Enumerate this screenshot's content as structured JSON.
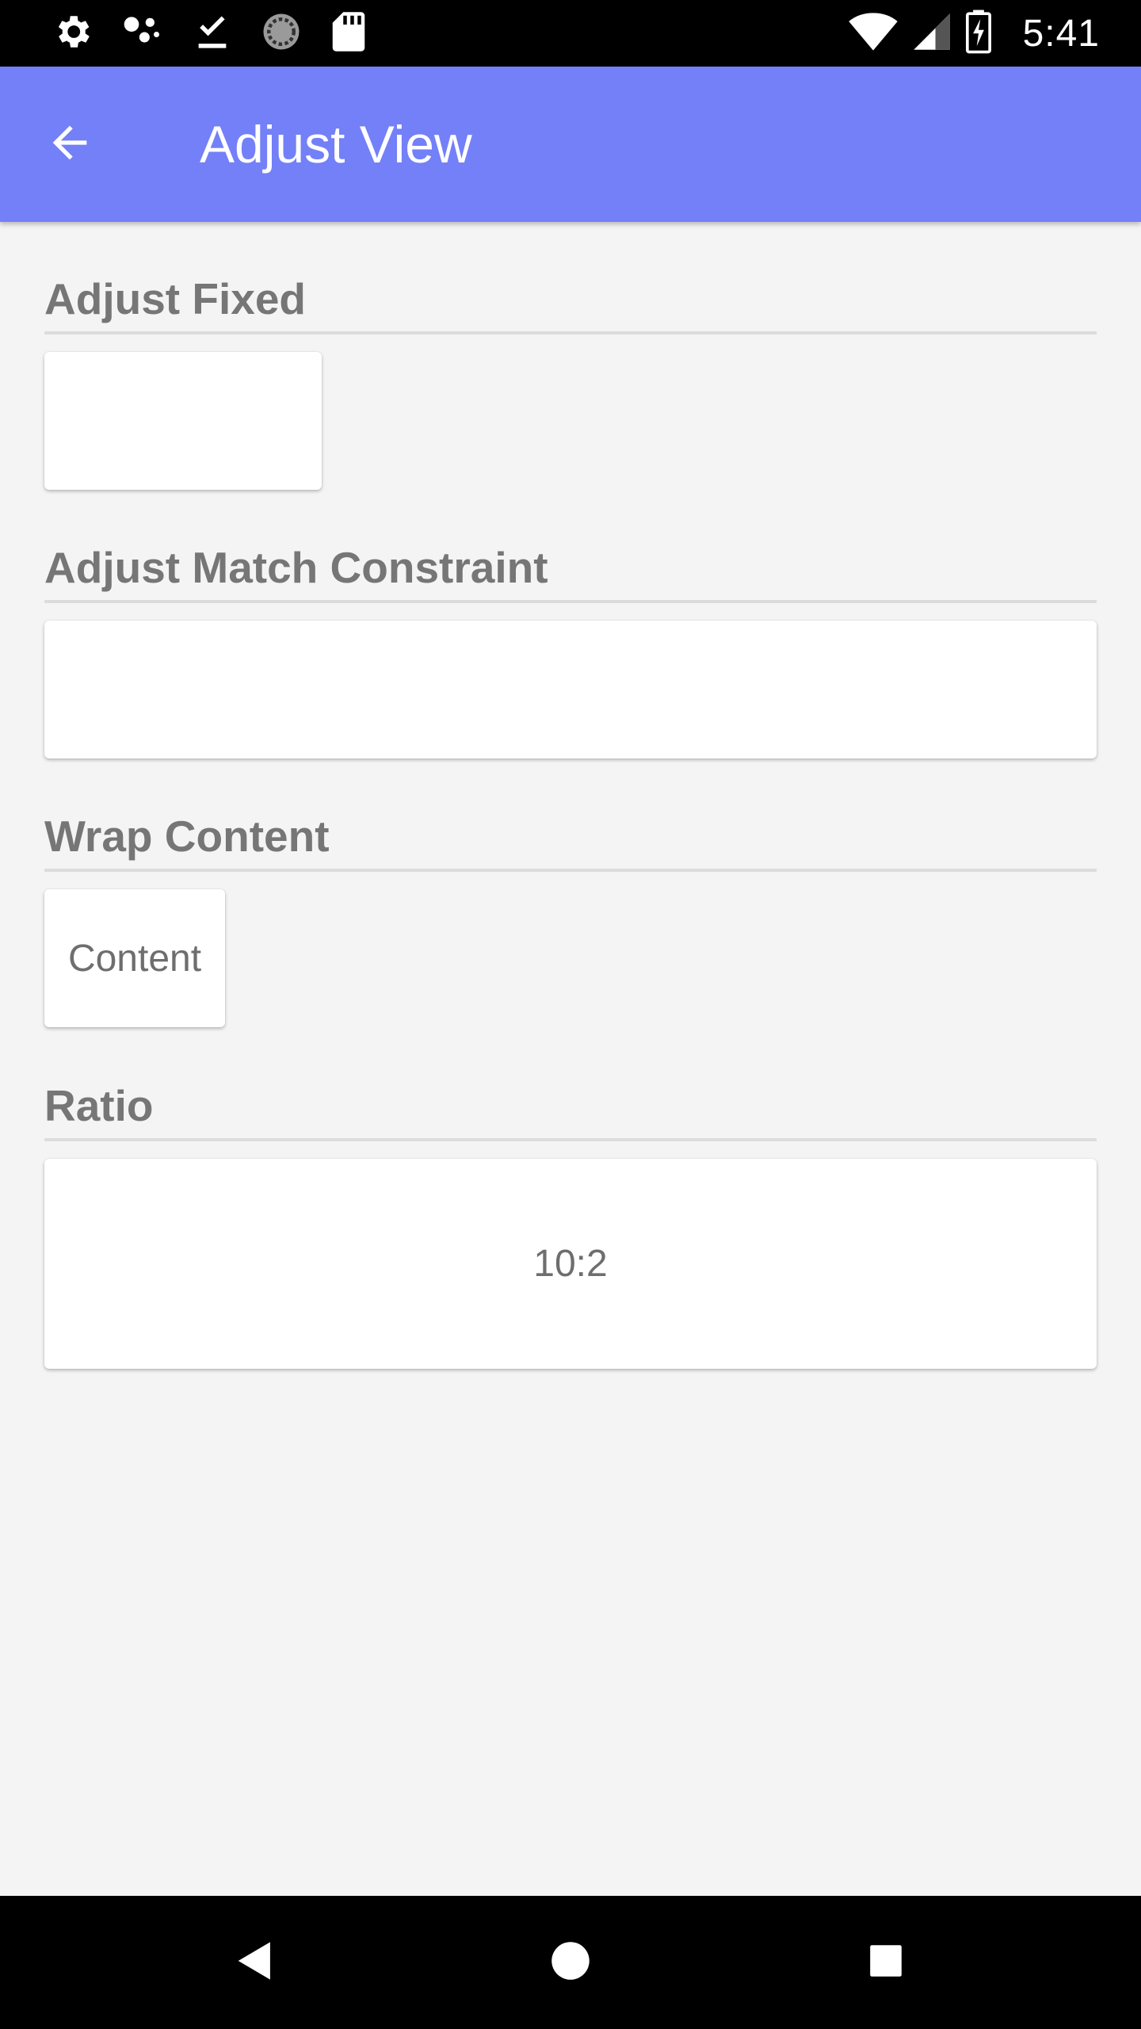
{
  "status_bar": {
    "time": "5:41",
    "left_icons": [
      "settings-icon",
      "assistant-dots-icon",
      "download-done-icon",
      "sync-progress-icon",
      "sd-card-icon"
    ],
    "right_icons": [
      "wifi-icon",
      "cell-signal-icon",
      "battery-charging-icon"
    ]
  },
  "app_bar": {
    "title": "Adjust View",
    "background_color": "#7380f8",
    "back_icon": "arrow-back-icon"
  },
  "sections": [
    {
      "title": "Adjust Fixed",
      "card_text": ""
    },
    {
      "title": "Adjust Match Constraint",
      "card_text": ""
    },
    {
      "title": "Wrap Content",
      "card_text": "Content"
    },
    {
      "title": "Ratio",
      "card_text": "10:2"
    }
  ],
  "nav_bar": {
    "icons": [
      "back-triangle-icon",
      "home-circle-icon",
      "recents-square-icon"
    ]
  }
}
